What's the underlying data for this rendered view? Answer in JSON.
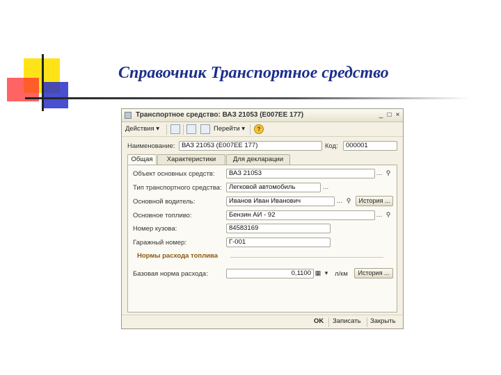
{
  "slide": {
    "title": "Справочник Транспортное средство"
  },
  "window": {
    "title": "Транспортное средство: ВАЗ 21053 (Е007ЕЕ 177)",
    "controls": [
      "_",
      "□",
      "×"
    ]
  },
  "toolbar": {
    "actions_label": "Действия",
    "goto_label": "Перейти",
    "help_label": "?"
  },
  "header": {
    "name_label": "Наименование:",
    "name_value": "ВАЗ 21053 (Е007ЕЕ 177)",
    "code_label": "Код:",
    "code_value": "000001"
  },
  "tabs": [
    "Общая",
    "Характеристики",
    "Для декларации"
  ],
  "general": {
    "asset_label": "Объект основных средств:",
    "asset_value": "ВАЗ 21053",
    "type_label": "Тип транспортного средства:",
    "type_value": "Легковой автомобиль",
    "driver_label": "Основной водитель:",
    "driver_value": "Иванов Иван Иванович",
    "fuel_label": "Основное топливо:",
    "fuel_value": "Бензин АИ - 92",
    "body_label": "Номер кузова:",
    "body_value": "84583169",
    "garage_label": "Гаражный номер:",
    "garage_value": "Г-001",
    "history_label": "История ..."
  },
  "fuel_norms": {
    "section_title": "Нормы расхода топлива",
    "base_label": "Базовая норма расхода:",
    "base_value": "0,1100",
    "unit": "л/км"
  },
  "footer": {
    "ok": "OK",
    "save": "Записать",
    "close": "Закрыть"
  }
}
